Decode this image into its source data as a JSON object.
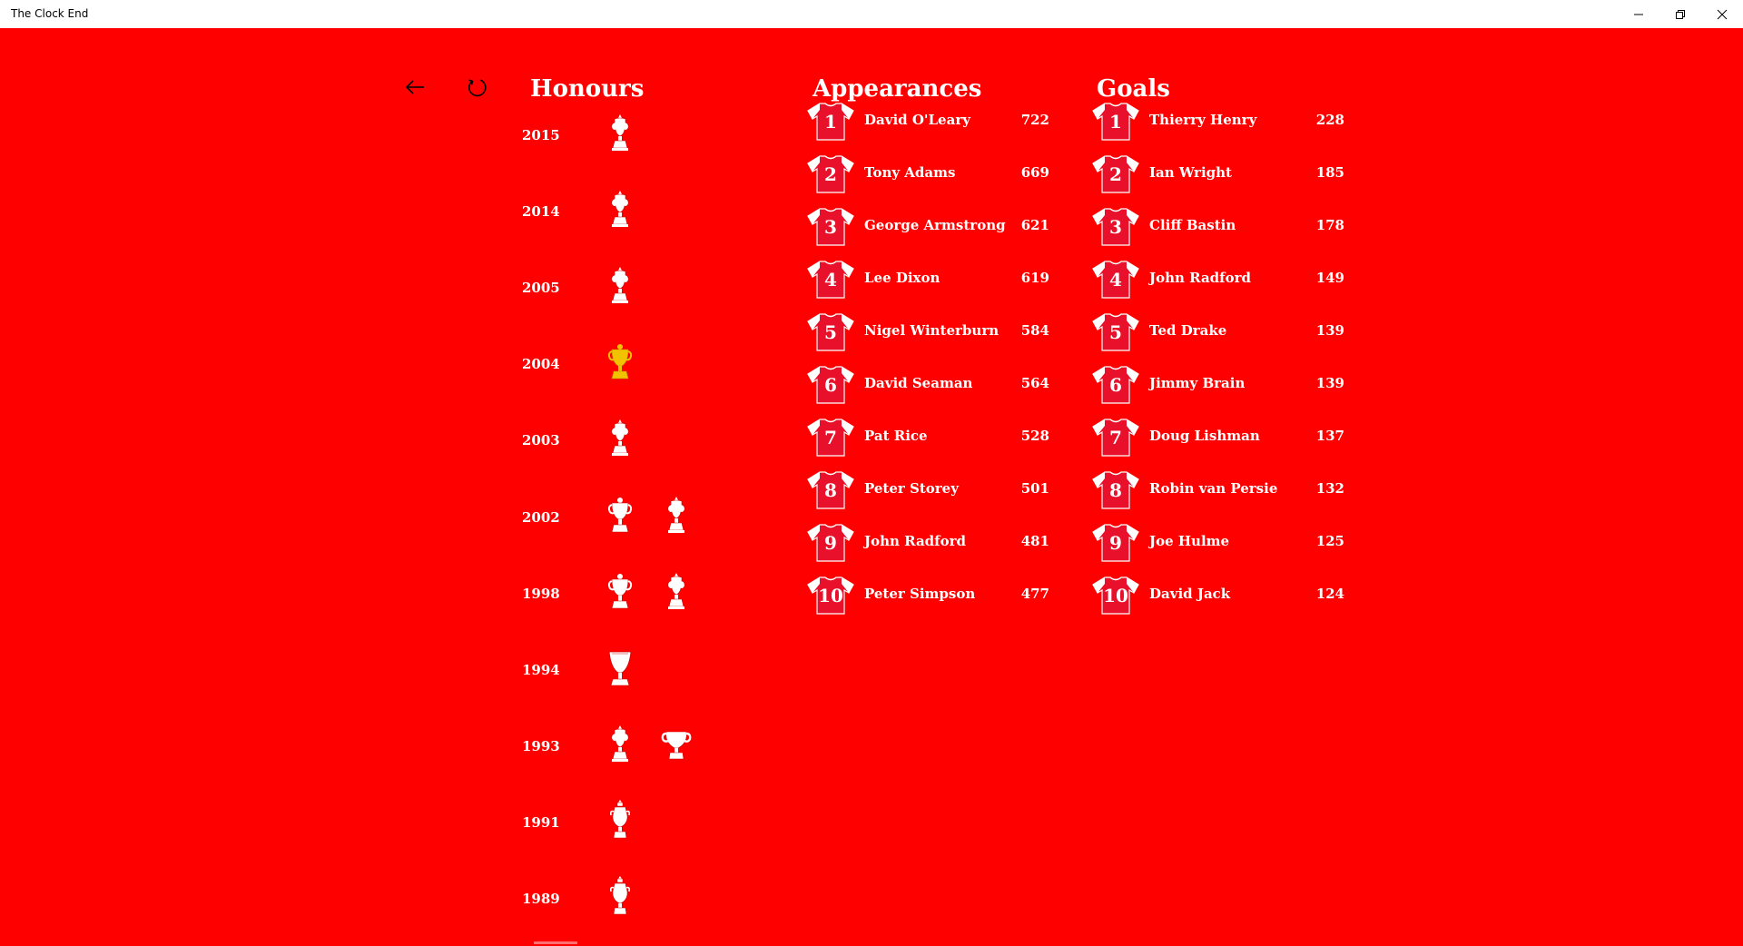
{
  "window": {
    "title": "The Clock End"
  },
  "nav": {
    "back_icon": "back-arrow-icon",
    "refresh_icon": "refresh-icon"
  },
  "honours": {
    "title": "Honours",
    "rows": [
      {
        "year": "2015",
        "trophies": [
          "fa-cup"
        ]
      },
      {
        "year": "2014",
        "trophies": [
          "fa-cup"
        ]
      },
      {
        "year": "2005",
        "trophies": [
          "fa-cup"
        ]
      },
      {
        "year": "2004",
        "trophies": [
          "premier-league-gold"
        ]
      },
      {
        "year": "2003",
        "trophies": [
          "fa-cup"
        ]
      },
      {
        "year": "2002",
        "trophies": [
          "premier-league",
          "fa-cup"
        ]
      },
      {
        "year": "1998",
        "trophies": [
          "premier-league",
          "fa-cup"
        ]
      },
      {
        "year": "1994",
        "trophies": [
          "cup-winners-cup"
        ]
      },
      {
        "year": "1993",
        "trophies": [
          "fa-cup",
          "league-cup"
        ]
      },
      {
        "year": "1991",
        "trophies": [
          "league-title"
        ]
      },
      {
        "year": "1989",
        "trophies": [
          "league-title"
        ]
      }
    ]
  },
  "appearances": {
    "title": "Appearances",
    "rows": [
      {
        "rank": "1",
        "name": "David O'Leary",
        "value": "722"
      },
      {
        "rank": "2",
        "name": "Tony Adams",
        "value": "669"
      },
      {
        "rank": "3",
        "name": "George Armstrong",
        "value": "621"
      },
      {
        "rank": "4",
        "name": "Lee Dixon",
        "value": "619"
      },
      {
        "rank": "5",
        "name": "Nigel Winterburn",
        "value": "584"
      },
      {
        "rank": "6",
        "name": "David Seaman",
        "value": "564"
      },
      {
        "rank": "7",
        "name": "Pat Rice",
        "value": "528"
      },
      {
        "rank": "8",
        "name": "Peter Storey",
        "value": "501"
      },
      {
        "rank": "9",
        "name": "John Radford",
        "value": "481"
      },
      {
        "rank": "10",
        "name": "Peter Simpson",
        "value": "477"
      }
    ]
  },
  "goals": {
    "title": "Goals",
    "rows": [
      {
        "rank": "1",
        "name": "Thierry Henry",
        "value": "228"
      },
      {
        "rank": "2",
        "name": "Ian Wright",
        "value": "185"
      },
      {
        "rank": "3",
        "name": "Cliff Bastin",
        "value": "178"
      },
      {
        "rank": "4",
        "name": "John Radford",
        "value": "149"
      },
      {
        "rank": "5",
        "name": "Ted Drake",
        "value": "139"
      },
      {
        "rank": "6",
        "name": "Jimmy Brain",
        "value": "139"
      },
      {
        "rank": "7",
        "name": "Doug Lishman",
        "value": "137"
      },
      {
        "rank": "8",
        "name": "Robin van Persie",
        "value": "132"
      },
      {
        "rank": "9",
        "name": "Joe Hulme",
        "value": "125"
      },
      {
        "rank": "10",
        "name": "David Jack",
        "value": "124"
      }
    ]
  },
  "colors": {
    "background": "#ff0000",
    "shirt_body": "#e8102a",
    "shirt_sleeve": "#ffffff",
    "gold": "#f2c200"
  }
}
